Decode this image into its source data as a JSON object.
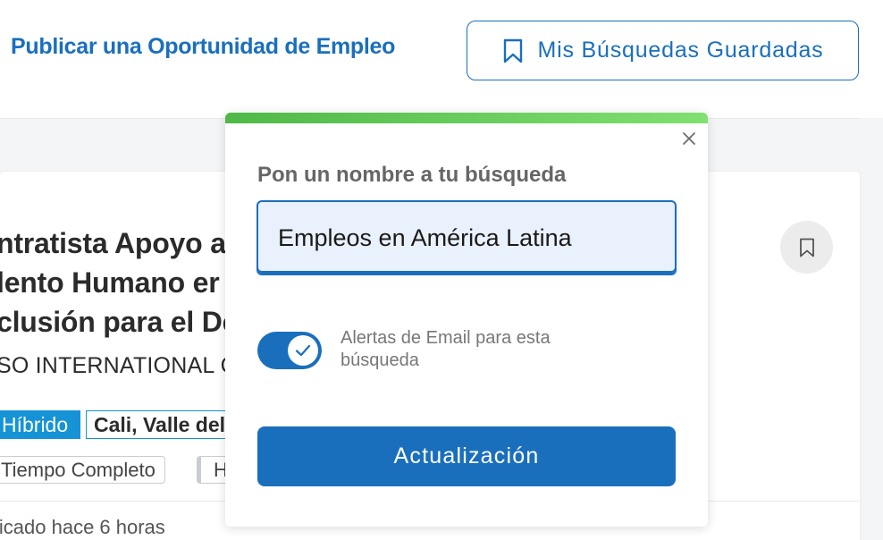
{
  "header": {
    "post_job_link": "Publicar una Oportunidad de Empleo",
    "saved_searches_button": "Mis Búsquedas Guardadas"
  },
  "job_card": {
    "title": "ntratista Apoyo a\nlento Humano er\nclusión para el De",
    "company": "SO INTERNATIONAL C",
    "work_mode": "Híbrido",
    "location": "Cali, Valle del",
    "job_type": "Tiempo Completo",
    "extra_tag": "H",
    "posted": "licado hace 6 horas"
  },
  "popup": {
    "label": "Pon un nombre a tu búsqueda",
    "search_name_value": "Empleos en América Latina",
    "email_alerts_label": "Alertas de Email para esta búsqueda",
    "email_alerts_enabled": true,
    "update_button": "Actualización"
  },
  "colors": {
    "primary": "#1a6fbd",
    "accent_green": "#5cc84f",
    "badge_blue": "#1593d6"
  }
}
